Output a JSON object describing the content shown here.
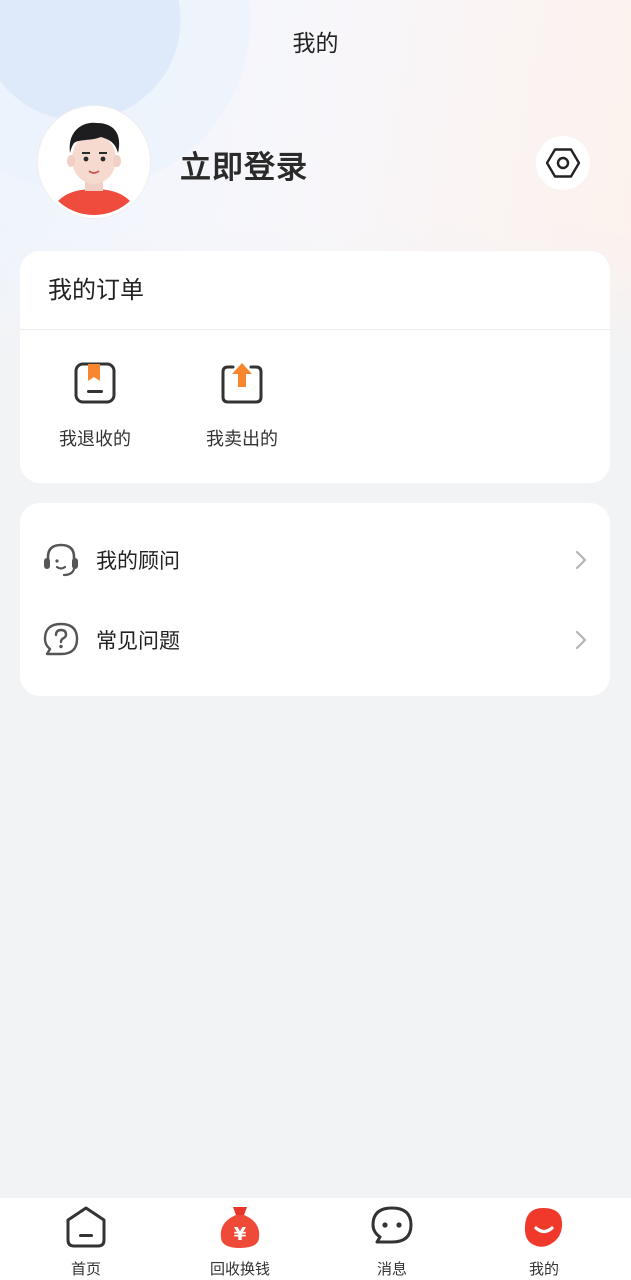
{
  "header": {
    "title": "我的"
  },
  "profile": {
    "login_text": "立即登录"
  },
  "orders": {
    "title": "我的订单",
    "items": [
      {
        "label": "我退收的",
        "icon": "return-box-icon"
      },
      {
        "label": "我卖出的",
        "icon": "sell-upload-icon"
      }
    ]
  },
  "menu": {
    "items": [
      {
        "label": "我的顾问",
        "icon": "headset-icon"
      },
      {
        "label": "常见问题",
        "icon": "question-bubble-icon"
      }
    ]
  },
  "tabbar": {
    "items": [
      {
        "label": "首页",
        "icon": "home-icon"
      },
      {
        "label": "回收换钱",
        "icon": "money-bag-icon"
      },
      {
        "label": "消息",
        "icon": "chat-bubble-icon"
      },
      {
        "label": "我的",
        "icon": "smile-profile-icon",
        "active": true
      }
    ]
  },
  "colors": {
    "accent": "#f0392b",
    "orange": "#f7862e",
    "text": "#222222",
    "bg": "#f2f3f5"
  }
}
